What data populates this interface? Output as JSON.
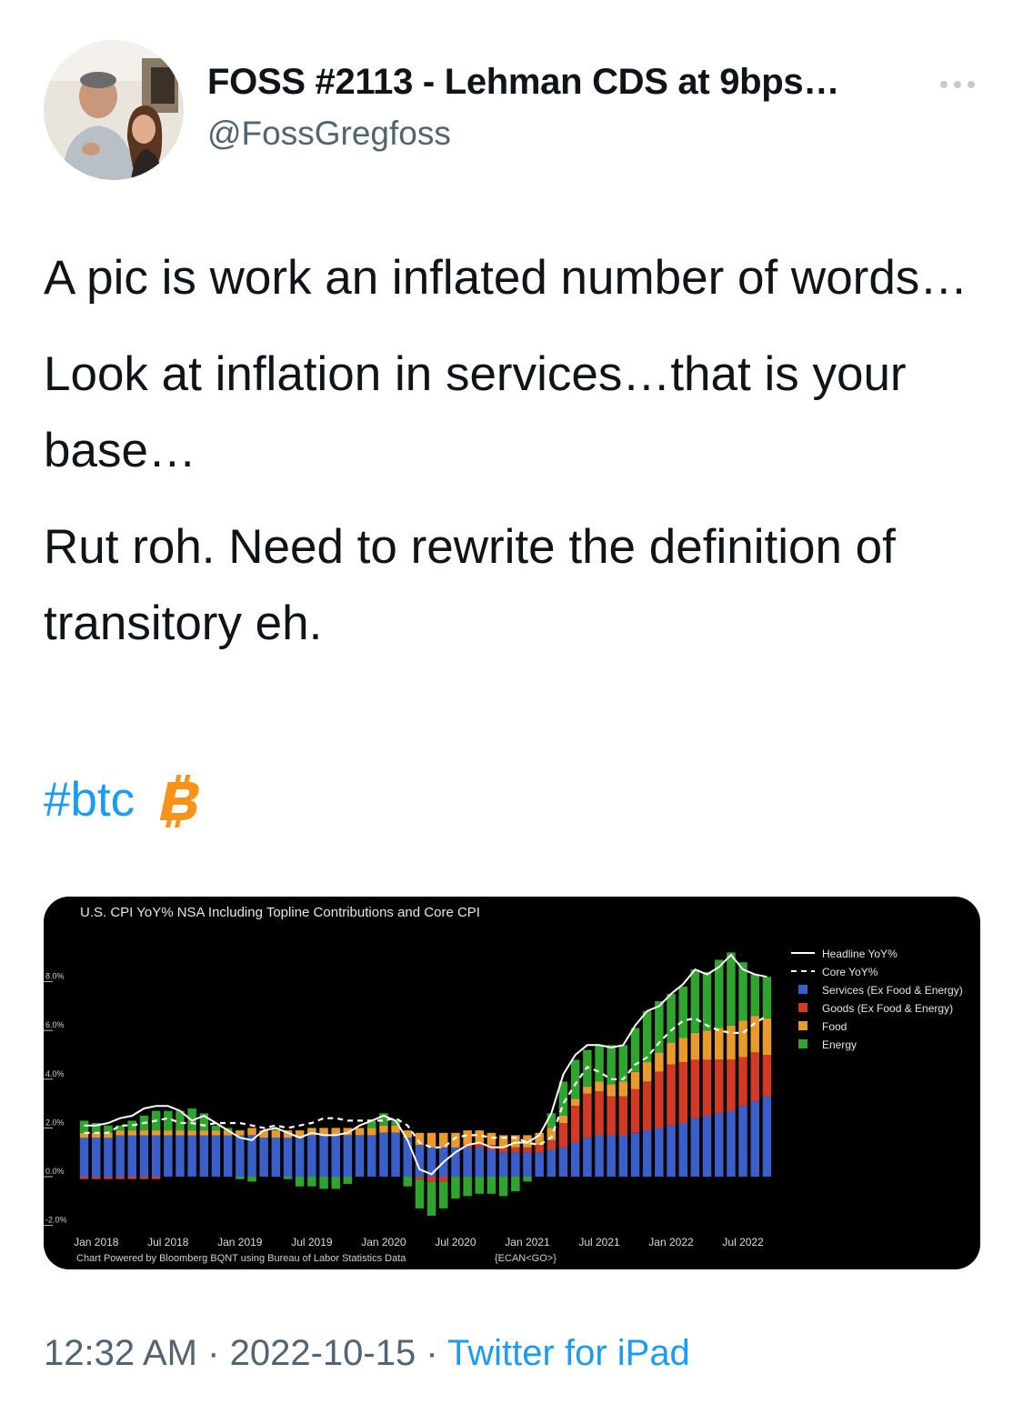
{
  "tweet": {
    "display_name": "FOSS #2113 - Lehman CDS at 9bps…",
    "handle": "@FossGregfoss",
    "paragraphs": [
      "A pic is work an inflated number of words…",
      "Look at inflation in services…that is your base…",
      "Rut roh.  Need to rewrite the definition of transitory eh."
    ],
    "hashtag": "#btc",
    "time": "12:32 AM",
    "separator": "·",
    "date": "2022-10-15",
    "source": "Twitter for iPad",
    "icons": {
      "more": "more-icon",
      "bitcoin": "bitcoin-icon",
      "avatar": "avatar-photo"
    }
  },
  "colors": {
    "hashtag": "#1d9bf0",
    "muted": "#536471",
    "bitcoin": "#f7931a",
    "services": "#3b5fc8",
    "goods": "#d23a26",
    "food": "#e89a2c",
    "energy": "#2fa52f"
  },
  "chart_data": {
    "type": "bar",
    "stacked": true,
    "title": "U.S. CPI YoY% NSA Including Topline Contributions and Core CPI",
    "footer": "Chart Powered by Bloomberg BQNT using Bureau of Labor Statistics Data",
    "footer_code": "{ECAN<GO>}",
    "ylim": [
      -2,
      9.5
    ],
    "y_ticks": [
      "8.0%",
      "6.0%",
      "4.0%",
      "2.0%",
      "0.0%",
      "-2.0%"
    ],
    "x_tick_labels": [
      "Jan 2018",
      "Jul 2018",
      "Jan 2019",
      "Jul 2019",
      "Jan 2020",
      "Jul 2020",
      "Jan 2021",
      "Jul 2021",
      "Jan 2022",
      "Jul 2022"
    ],
    "legend_position": "right",
    "legend": [
      "Headline YoY%",
      "Core YoY%",
      "Services (Ex Food & Energy)",
      "Goods (Ex Food & Energy)",
      "Food",
      "Energy"
    ],
    "categories": [
      "2017-12",
      "2018-01",
      "2018-02",
      "2018-03",
      "2018-04",
      "2018-05",
      "2018-06",
      "2018-07",
      "2018-08",
      "2018-09",
      "2018-10",
      "2018-11",
      "2018-12",
      "2019-01",
      "2019-02",
      "2019-03",
      "2019-04",
      "2019-05",
      "2019-06",
      "2019-07",
      "2019-08",
      "2019-09",
      "2019-10",
      "2019-11",
      "2019-12",
      "2020-01",
      "2020-02",
      "2020-03",
      "2020-04",
      "2020-05",
      "2020-06",
      "2020-07",
      "2020-08",
      "2020-09",
      "2020-10",
      "2020-11",
      "2020-12",
      "2021-01",
      "2021-02",
      "2021-03",
      "2021-04",
      "2021-05",
      "2021-06",
      "2021-07",
      "2021-08",
      "2021-09",
      "2021-10",
      "2021-11",
      "2021-12",
      "2022-01",
      "2022-02",
      "2022-03",
      "2022-04",
      "2022-05",
      "2022-06",
      "2022-07",
      "2022-08",
      "2022-09"
    ],
    "series": [
      {
        "name": "Services (Ex Food & Energy)",
        "values": [
          1.6,
          1.6,
          1.6,
          1.7,
          1.7,
          1.7,
          1.7,
          1.7,
          1.7,
          1.7,
          1.7,
          1.7,
          1.7,
          1.7,
          1.7,
          1.6,
          1.6,
          1.6,
          1.6,
          1.7,
          1.7,
          1.7,
          1.7,
          1.7,
          1.7,
          1.8,
          1.8,
          1.6,
          1.3,
          1.2,
          1.2,
          1.2,
          1.2,
          1.2,
          1.1,
          1.0,
          1.0,
          1.0,
          1.0,
          1.1,
          1.2,
          1.4,
          1.6,
          1.7,
          1.7,
          1.7,
          1.8,
          1.9,
          2.0,
          2.1,
          2.2,
          2.4,
          2.5,
          2.6,
          2.7,
          2.9,
          3.1,
          3.3
        ]
      },
      {
        "name": "Goods (Ex Food & Energy)",
        "values": [
          -0.1,
          -0.1,
          -0.1,
          -0.1,
          -0.1,
          -0.1,
          -0.1,
          0.0,
          0.0,
          0.0,
          0.0,
          0.0,
          0.0,
          0.0,
          0.0,
          0.0,
          0.0,
          0.0,
          0.0,
          0.0,
          0.0,
          0.0,
          0.0,
          0.0,
          0.0,
          0.0,
          0.0,
          0.0,
          -0.1,
          -0.2,
          -0.2,
          0.0,
          0.1,
          0.2,
          0.2,
          0.2,
          0.2,
          0.2,
          0.3,
          0.4,
          1.0,
          1.5,
          1.8,
          1.8,
          1.6,
          1.6,
          1.8,
          2.0,
          2.3,
          2.5,
          2.5,
          2.4,
          2.3,
          2.2,
          2.1,
          2.0,
          2.0,
          1.7
        ]
      },
      {
        "name": "Food",
        "values": [
          0.2,
          0.2,
          0.2,
          0.2,
          0.2,
          0.2,
          0.2,
          0.2,
          0.2,
          0.2,
          0.2,
          0.2,
          0.2,
          0.2,
          0.3,
          0.3,
          0.3,
          0.3,
          0.3,
          0.3,
          0.3,
          0.3,
          0.3,
          0.3,
          0.3,
          0.3,
          0.3,
          0.3,
          0.5,
          0.6,
          0.6,
          0.6,
          0.6,
          0.5,
          0.5,
          0.5,
          0.5,
          0.5,
          0.5,
          0.5,
          0.3,
          0.3,
          0.3,
          0.4,
          0.5,
          0.6,
          0.7,
          0.8,
          0.8,
          0.9,
          1.0,
          1.1,
          1.2,
          1.3,
          1.4,
          1.5,
          1.5,
          1.5
        ]
      },
      {
        "name": "Energy",
        "values": [
          0.5,
          0.4,
          0.3,
          0.2,
          0.4,
          0.6,
          0.8,
          0.8,
          0.8,
          0.9,
          0.7,
          0.2,
          0.1,
          -0.1,
          -0.2,
          0.0,
          0.1,
          -0.1,
          -0.4,
          -0.4,
          -0.5,
          -0.5,
          -0.3,
          0.0,
          0.3,
          0.5,
          0.2,
          -0.4,
          -1.2,
          -1.4,
          -1.1,
          -0.9,
          -0.8,
          -0.7,
          -0.7,
          -0.8,
          -0.6,
          -0.2,
          0.0,
          0.6,
          1.4,
          1.6,
          1.5,
          1.5,
          1.6,
          1.5,
          1.8,
          2.1,
          2.1,
          2.0,
          2.1,
          2.6,
          2.4,
          2.8,
          3.0,
          2.4,
          1.7,
          1.7
        ]
      }
    ],
    "lines": [
      {
        "name": "Headline YoY%",
        "style": "solid",
        "values": [
          2.1,
          2.1,
          2.2,
          2.4,
          2.5,
          2.8,
          2.9,
          2.9,
          2.7,
          2.3,
          2.5,
          2.2,
          1.9,
          1.6,
          1.5,
          1.9,
          2.0,
          1.8,
          1.6,
          1.8,
          1.7,
          1.7,
          1.8,
          2.1,
          2.3,
          2.5,
          2.3,
          1.5,
          0.3,
          0.1,
          0.6,
          1.0,
          1.3,
          1.4,
          1.2,
          1.2,
          1.4,
          1.4,
          1.7,
          2.6,
          4.2,
          5.0,
          5.4,
          5.4,
          5.3,
          5.4,
          6.2,
          6.8,
          7.0,
          7.5,
          7.9,
          8.5,
          8.3,
          8.6,
          9.1,
          8.5,
          8.3,
          8.2
        ]
      },
      {
        "name": "Core YoY%",
        "style": "dashed",
        "values": [
          1.8,
          1.8,
          1.8,
          2.1,
          2.1,
          2.2,
          2.3,
          2.4,
          2.2,
          2.2,
          2.1,
          2.2,
          2.2,
          2.2,
          2.1,
          2.0,
          2.1,
          2.0,
          2.1,
          2.2,
          2.4,
          2.4,
          2.3,
          2.3,
          2.3,
          2.3,
          2.4,
          2.1,
          1.4,
          1.2,
          1.2,
          1.6,
          1.7,
          1.7,
          1.6,
          1.6,
          1.6,
          1.4,
          1.3,
          1.6,
          3.0,
          3.8,
          4.5,
          4.3,
          4.0,
          4.0,
          4.6,
          4.9,
          5.5,
          6.0,
          6.4,
          6.5,
          6.2,
          6.0,
          5.9,
          5.9,
          6.3,
          6.6
        ]
      }
    ]
  }
}
